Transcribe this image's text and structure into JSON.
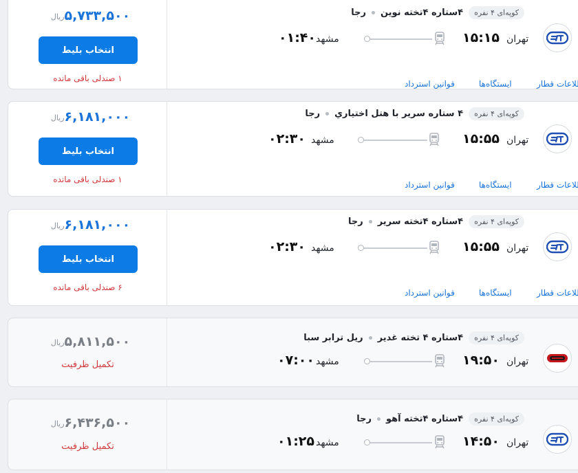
{
  "currency": "ریال",
  "select_label": "انتخاب بلیط",
  "links": {
    "train_info": "اطلاعات قطار",
    "stations": "ایستگاه‌ها",
    "refund": "قوانین استرداد"
  },
  "colors": {
    "primary": "#0d7be6",
    "price_blue": "#1a73d9",
    "price_gray": "#7a7f86",
    "alert_red": "#d0363b",
    "raja_logo": "#1f4fb3",
    "red_logo": "#c4161c"
  },
  "tickets": [
    {
      "coupe": "کوپه‌ای ۴ نفره",
      "name": "۴ستاره ۴تخته نوین",
      "company": "رجا",
      "logo": "raja-logo-icon",
      "dep_city": "تهران",
      "dep_time": "۱۵:۱۵",
      "arr_city": "مشهد",
      "arr_time": "۰۱:۴۰",
      "price": "۵,۷۳۳,۵۰۰",
      "status": "۱ صندلی باقی مانده",
      "available": true
    },
    {
      "coupe": "کوپه‌ای ۴ نفره",
      "name": "۴ ستاره سرير با هتل اختياري",
      "company": "رجا",
      "logo": "raja-logo-icon",
      "dep_city": "تهران",
      "dep_time": "۱۵:۵۵",
      "arr_city": "مشهد",
      "arr_time": "۰۲:۳۰",
      "price": "۶,۱۸۱,۰۰۰",
      "status": "۱ صندلی باقی مانده",
      "available": true
    },
    {
      "coupe": "کوپه‌ای ۴ نفره",
      "name": "۴ستاره ۴تخته سرير",
      "company": "رجا",
      "logo": "raja-logo-icon",
      "dep_city": "تهران",
      "dep_time": "۱۵:۵۵",
      "arr_city": "مشهد",
      "arr_time": "۰۲:۳۰",
      "price": "۶,۱۸۱,۰۰۰",
      "status": "۶ صندلی باقی مانده",
      "available": true
    },
    {
      "coupe": "کوپه‌ای ۴ نفره",
      "name": "۴ستاره ۴ تخته غدیر",
      "company": "ریل ترابر سبا",
      "logo": "saba-logo-icon",
      "dep_city": "تهران",
      "dep_time": "۱۹:۵۰",
      "arr_city": "مشهد",
      "arr_time": "۰۷:۰۰",
      "price": "۵,۸۱۱,۵۰۰",
      "status": "تکمیل ظرفیت",
      "available": false
    },
    {
      "coupe": "کوپه‌ای ۴ نفره",
      "name": "۴ستاره ۴تخته آهو",
      "company": "رجا",
      "logo": "raja-logo-icon",
      "dep_city": "تهران",
      "dep_time": "۱۴:۵۰",
      "arr_city": "مشهد",
      "arr_time": "۰۱:۲۵",
      "price": "۶,۴۳۶,۵۰۰",
      "status": "تکمیل ظرفیت",
      "available": false
    }
  ]
}
